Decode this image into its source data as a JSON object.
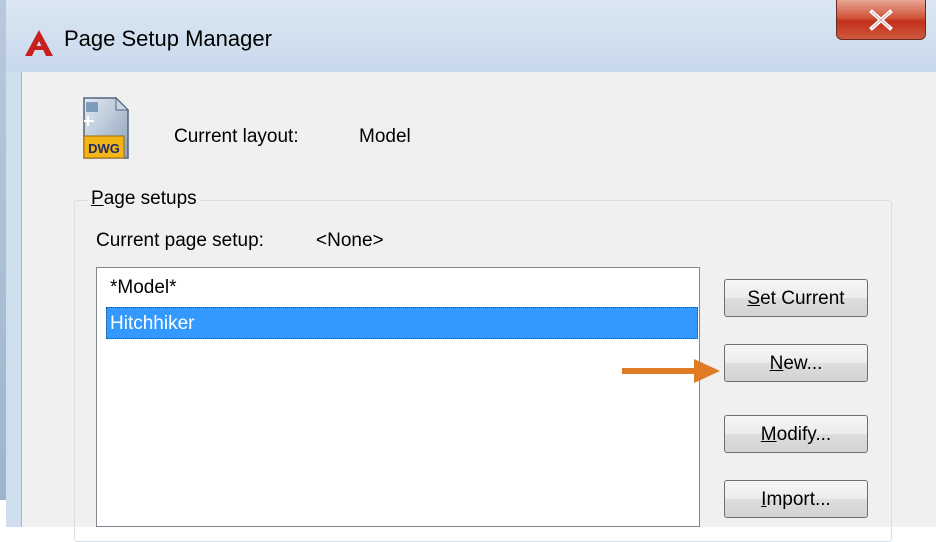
{
  "window": {
    "title": "Page Setup Manager",
    "close_label": "X"
  },
  "header": {
    "icon_label": "DWG",
    "current_layout_label": "Current layout:",
    "current_layout_value": "Model"
  },
  "page_setups": {
    "legend_first_char": "P",
    "legend_rest": "age setups",
    "current_setup_label": "Current page setup:",
    "current_setup_value": "<None>",
    "items": [
      {
        "label": "*Model*",
        "selected": false
      },
      {
        "label": "Hitchhiker",
        "selected": true
      }
    ]
  },
  "buttons": {
    "set_current": {
      "mnemonic": "S",
      "rest": "et Current"
    },
    "new": {
      "mnemonic": "N",
      "rest": "ew..."
    },
    "modify": {
      "mnemonic": "M",
      "rest": "odify..."
    },
    "import": {
      "mnemonic": "I",
      "rest": "mport..."
    }
  },
  "colors": {
    "selection": "#3399ff",
    "arrow": "#e07a24",
    "close_button": "#c9432a"
  },
  "icons": [
    "autocad-logo-icon",
    "close-icon",
    "dwg-file-icon",
    "arrow-right-icon"
  ]
}
